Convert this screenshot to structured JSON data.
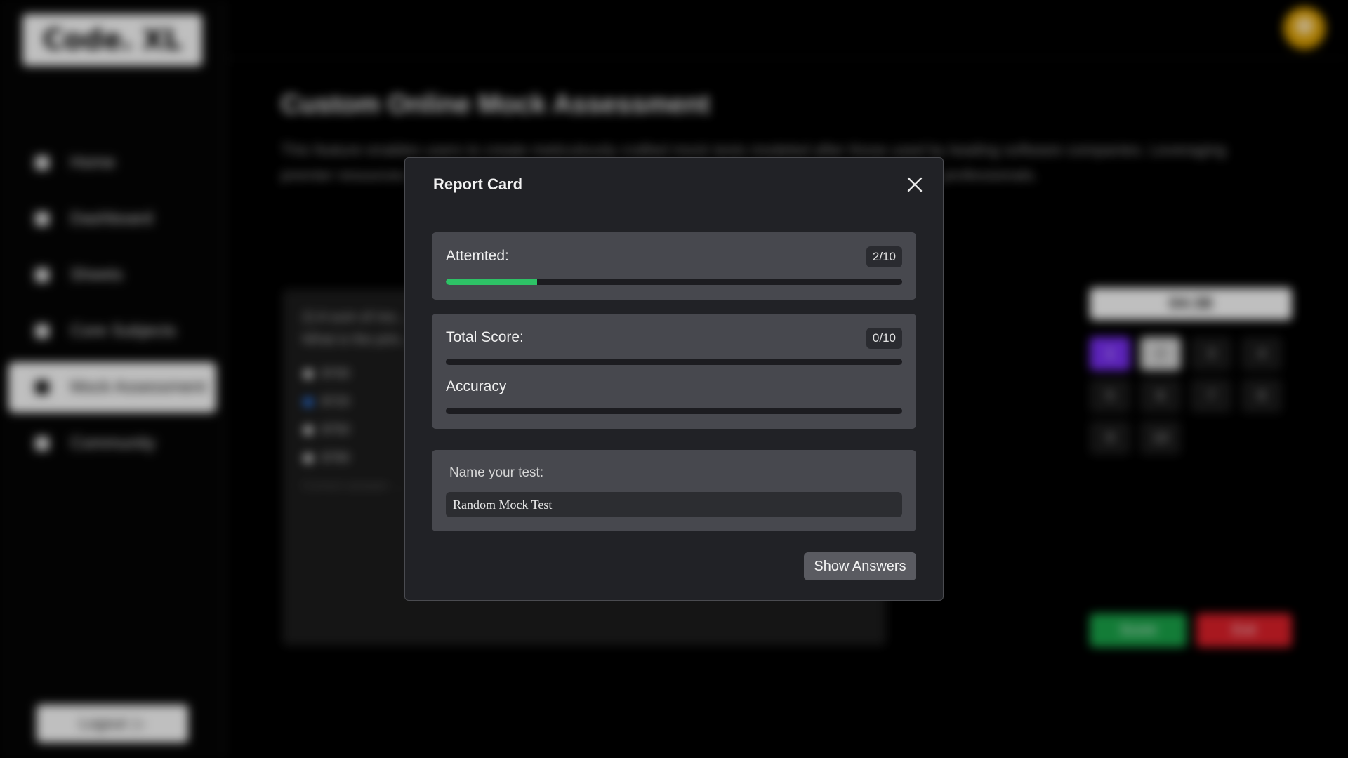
{
  "app": {
    "logo": "Code. XL"
  },
  "sidebar": {
    "items": [
      {
        "label": "Home",
        "icon": "home-icon"
      },
      {
        "label": "Dashboard",
        "icon": "dashboard-icon"
      },
      {
        "label": "Sheets",
        "icon": "sheets-icon"
      },
      {
        "label": "Core Subjects",
        "icon": "laptop-icon"
      },
      {
        "label": "Mock Assessment",
        "icon": "mock-icon",
        "active": true
      },
      {
        "label": "Community",
        "icon": "community-icon"
      }
    ],
    "logout_label": "Logout"
  },
  "page": {
    "title": "Custom Online Mock Assessment",
    "description": "This feature enables users to create meticulously crafted mock tests modeled after those used by leading software companies. Leveraging premier resources ... Database Management Systems (DBMS), Operating Systems (OS), and ... professionals."
  },
  "question": {
    "text_line1": "2) A sum of mo...",
    "text_line2": "What is the prin...",
    "options": [
      "$700",
      "$720",
      "$750",
      "$780"
    ],
    "selected_index": 1,
    "answer_label": "Correct answer: ..."
  },
  "timer": "04:38",
  "question_nav": {
    "numbers": [
      "1",
      "2",
      "3",
      "4",
      "5",
      "6",
      "7",
      "8",
      "9",
      "10"
    ],
    "current": "1",
    "visited": [
      "2"
    ]
  },
  "actions": {
    "score_label": "Score",
    "exit_label": "Exit"
  },
  "colors": {
    "accent_purple": "#7b2ff7",
    "progress_green": "#2ec266",
    "score_green": "#1aa64a",
    "exit_red": "#e0202a"
  },
  "modal": {
    "title": "Report Card",
    "attempted": {
      "label": "Attemted:",
      "value": "2/10",
      "fraction": 0.2
    },
    "total_score": {
      "label": "Total Score:",
      "value": "0/10",
      "fraction": 0
    },
    "accuracy": {
      "label": "Accuracy",
      "fraction": 0
    },
    "name_test": {
      "label": "Name your test:",
      "value": "Random Mock Test"
    },
    "show_answers_label": "Show Answers"
  }
}
